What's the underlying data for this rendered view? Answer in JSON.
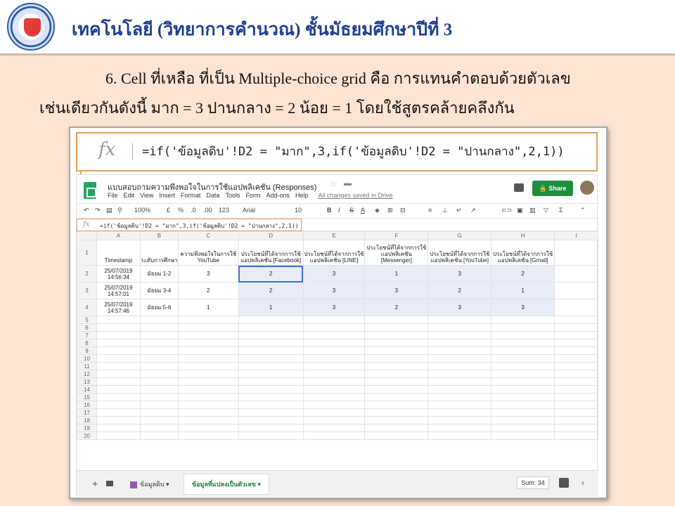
{
  "slide": {
    "title": "เทคโนโลยี (วิทยาการคำนวณ) ชั้นมัธยมศึกษาปีที่ 3",
    "line1": "6. Cell ที่เหลือ ที่เป็น Multiple-choice  grid คือ การแทนคำตอบด้วยตัวเลข",
    "line2": "เช่นเดียวกันดังนี้ มาก = 3 ปานกลาง = 2 น้อย = 1  โดยใช้สูตรคล้ายคลึงกัน"
  },
  "formula": {
    "fx": "fx",
    "text": "=if('ข้อมูลดิบ'!D2 = \"มาก\",3,if('ข้อมูลดิบ'!D2 = \"ปานกลาง\",2,1))"
  },
  "app": {
    "doc_title": "แบบสอบถามความพึงพอใจในการใช้แอปพลิเคชัน (Responses)",
    "menu": [
      "File",
      "Edit",
      "View",
      "Insert",
      "Format",
      "Data",
      "Tools",
      "Form",
      "Add-ons",
      "Help"
    ],
    "save_status": "All changes saved in Drive",
    "share_label": "Share",
    "toolbar": {
      "zoom": "100%",
      "currency": "£",
      "percent": "%",
      "dec_less": ".0",
      "dec_more": ".00",
      "more_formats": "123",
      "font": "Arial",
      "font_size": "10",
      "bold": "B",
      "italic": "I",
      "strike": "S",
      "text_color": "A"
    },
    "small_formula": "=if('ข้อมูลดิบ'!D2 = \"มาก\",3,if('ข้อมูลดิบ'!D2 = \"ปานกลาง\",2,1))"
  },
  "grid": {
    "col_letters": [
      "A",
      "B",
      "C",
      "D",
      "E",
      "F",
      "G",
      "H",
      "I"
    ],
    "headers": [
      "Timestamp",
      "ระดับการศึกษา",
      "ความพึงพอใจในการใช้ YouTube",
      "ประโยชน์ที่ได้จากการใช้แอปพลิเคชัน [Facebook]",
      "ประโยชน์ที่ได้จากการใช้แอปพลิเคชัน [LINE]",
      "ประโยชน์ที่ได้จากการใช้แอปพลิเคชัน [Messenger]",
      "ประโยชน์ที่ได้จากการใช้แอปพลิเคชัน [YouTube]",
      "ประโยชน์ที่ได้จากการใช้แอปพลิเคชัน [Gmail]",
      ""
    ],
    "rows": [
      [
        "25/07/2019 14:56:34",
        "มัธยม 1-2",
        "3",
        "2",
        "3",
        "1",
        "3",
        "2",
        ""
      ],
      [
        "25/07/2019 14:57:01",
        "มัธยม 3-4",
        "2",
        "2",
        "3",
        "3",
        "2",
        "1",
        ""
      ],
      [
        "25/07/2019 14:57:46",
        "มัธยม 5-6",
        "1",
        "1",
        "3",
        "2",
        "3",
        "3",
        ""
      ]
    ],
    "row_numbers": [
      "1",
      "2",
      "3",
      "4",
      "5",
      "6",
      "7",
      "8",
      "9",
      "10",
      "11",
      "12",
      "13",
      "14",
      "15",
      "16",
      "17",
      "18",
      "19",
      "20"
    ]
  },
  "tabs": {
    "tab1": "ข้อมูลดิบ",
    "tab2": "ข้อมูลที่แปลงเป็นตัวเลข",
    "sum": "Sum: 34"
  }
}
